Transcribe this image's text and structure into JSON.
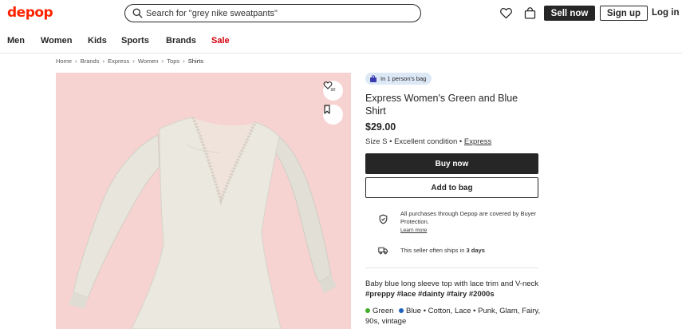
{
  "header": {
    "logo": "depop",
    "search_placeholder": "Search for \"grey nike sweatpants\"",
    "sell_label": "Sell now",
    "signup_label": "Sign up",
    "login_label": "Log in"
  },
  "nav": {
    "items": [
      "Men",
      "Women",
      "Kids",
      "Sports",
      "Brands",
      "Sale"
    ]
  },
  "breadcrumb": [
    "Home",
    "Brands",
    "Express",
    "Women",
    "Tops",
    "Shirts"
  ],
  "listing": {
    "like_count": "92",
    "bag_badge": "In 1 person's bag",
    "title": "Express Women's Green and Blue Shirt",
    "price": "$29.00",
    "size": "Size S",
    "condition": "Excellent condition",
    "brand": "Express",
    "buy_label": "Buy now",
    "add_bag_label": "Add to bag",
    "protection_text": "All purchases through Depop are covered by Buyer Protection.",
    "learn_more": "Learn more",
    "shipping_prefix": "This seller often ships in",
    "shipping_days": "3 days",
    "description_text": "Baby blue long sleeve top with lace trim and V-neck",
    "hashtags": "#preppy #lace #dainty #fairy #2000s",
    "colors": [
      {
        "name": "Green",
        "hex": "#3fae29"
      },
      {
        "name": "Blue",
        "hex": "#1f5fbf"
      }
    ],
    "material": "Cotton, Lace",
    "styles": "Punk, Glam, Fairy, 90s, vintage"
  },
  "colors": {
    "brand_red": "#ff2300",
    "sale_red": "#d7000c",
    "image_bg": "#f6d3d1",
    "badge_bg": "#dde8f7"
  }
}
